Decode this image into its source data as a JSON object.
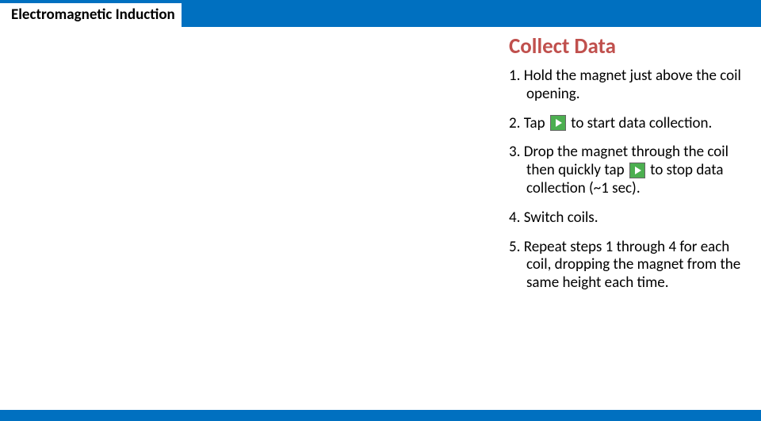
{
  "header": {
    "title": "Electromagnetic Induction"
  },
  "section": {
    "title": "Collect Data"
  },
  "steps": {
    "s1_num": "1.",
    "s1_text": "Hold the magnet just above the coil opening.",
    "s2_num": "2.",
    "s2_a": "Tap ",
    "s2_b": " to start data collection.",
    "s3_num": "3.",
    "s3_a": "Drop the magnet through the coil then quickly tap ",
    "s3_b": " to stop data collection (~1 sec).",
    "s4_num": "4.",
    "s4_text": "Switch coils.",
    "s5_num": "5.",
    "s5_text": "Repeat steps 1 through 4 for each coil, dropping the magnet from the same height each time."
  }
}
